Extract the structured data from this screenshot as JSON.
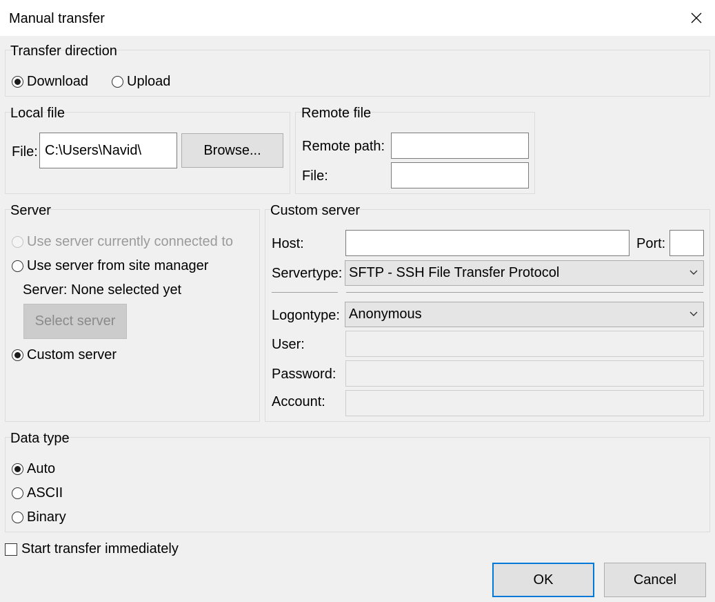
{
  "window": {
    "title": "Manual transfer"
  },
  "transfer_direction": {
    "legend": "Transfer direction",
    "download_label": "Download",
    "upload_label": "Upload",
    "selected": "Download"
  },
  "local_file": {
    "legend": "Local file",
    "file_label": "File:",
    "file_value": "C:\\Users\\Navid\\",
    "browse_label": "Browse..."
  },
  "remote_file": {
    "legend": "Remote file",
    "remote_path_label": "Remote path:",
    "remote_path_value": "",
    "file_label": "File:",
    "file_value": ""
  },
  "server": {
    "legend": "Server",
    "current_label": "Use server currently connected to",
    "site_manager_label": "Use server from site manager",
    "server_info": "Server: None selected yet",
    "select_server_label": "Select server",
    "custom_label": "Custom server",
    "selected": "Custom server"
  },
  "custom_server": {
    "legend": "Custom server",
    "host_label": "Host:",
    "host_value": "",
    "port_label": "Port:",
    "port_value": "",
    "servertype_label": "Servertype:",
    "servertype_value": "SFTP - SSH File Transfer Protocol",
    "logontype_label": "Logontype:",
    "logontype_value": "Anonymous",
    "user_label": "User:",
    "password_label": "Password:",
    "account_label": "Account:"
  },
  "data_type": {
    "legend": "Data type",
    "auto_label": "Auto",
    "ascii_label": "ASCII",
    "binary_label": "Binary",
    "selected": "Auto"
  },
  "start_immediately": {
    "label": "Start transfer immediately",
    "checked": false
  },
  "buttons": {
    "ok_label": "OK",
    "cancel_label": "Cancel"
  },
  "icons": {
    "close": "close-icon",
    "dropdown": "chevron-down-icon",
    "radio": "radio-icon",
    "checkbox": "checkbox-icon"
  },
  "colors": {
    "accent": "#0078d7",
    "background": "#f0f0f0"
  }
}
